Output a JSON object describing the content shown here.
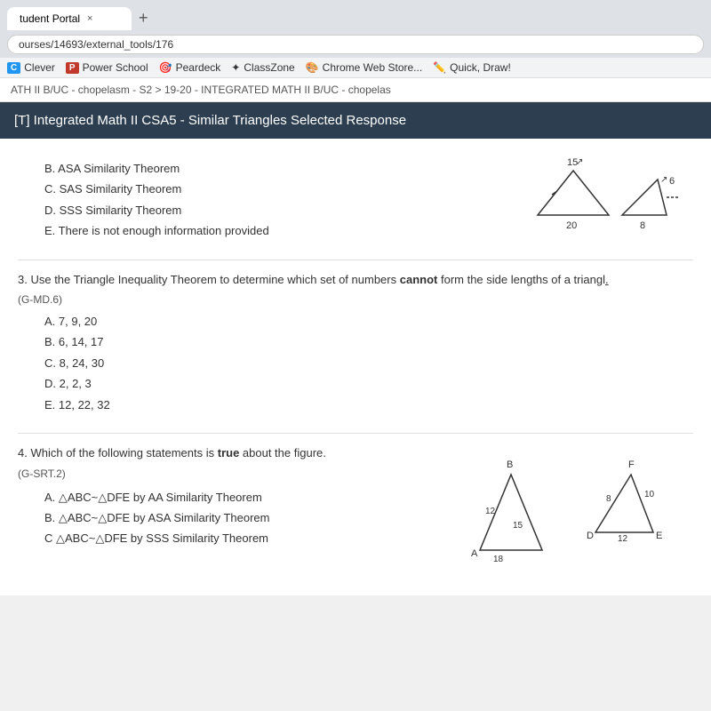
{
  "browser": {
    "tab_label": "tudent Portal",
    "tab_close": "×",
    "tab_new": "+",
    "address": "ourses/14693/external_tools/176"
  },
  "bookmarks": [
    {
      "id": "clever",
      "label": "Clever",
      "badge": "C",
      "color": "#2196F3"
    },
    {
      "id": "powerschool",
      "label": "Power School",
      "badge": "P",
      "color": "#c0392b"
    },
    {
      "id": "peardeck",
      "label": "Peardeck",
      "badge": "🎯"
    },
    {
      "id": "classzone",
      "label": "ClassZone",
      "badge": "✦"
    },
    {
      "id": "chrome-web",
      "label": "Chrome Web Store...",
      "badge": "🎨"
    },
    {
      "id": "quick-draw",
      "label": "Quick, Draw!",
      "badge": "✏️"
    }
  ],
  "breadcrumb": "ATH II B/UC - chopelasm - S2  >  19-20 - INTEGRATED MATH II B/UC - chopelas",
  "page_header": "[T] Integrated Math II CSA5 - Similar Triangles Selected Response",
  "questions": {
    "q2_choices": [
      "B. ASA Similarity Theorem",
      "C. SAS Similarity Theorem",
      "D. SSS Similarity Theorem",
      "E. There is not enough information provided"
    ],
    "q2_diagram": {
      "label1": "15",
      "label2": "6",
      "label3": "20",
      "label4": "8"
    },
    "q3_number": "3.",
    "q3_text": "Use the Triangle Inequality Theorem to determine which set of numbers",
    "q3_bold": "cannot",
    "q3_text2": "form the side lengths of a triangl",
    "q3_tag": "(G-MD.6)",
    "q3_choices": [
      "A. 7, 9, 20",
      "B. 6, 14, 17",
      "C. 8, 24, 30",
      "D. 2, 2, 3",
      "E. 12, 22, 32"
    ],
    "q4_number": "4.",
    "q4_text": "Which of the following statements is",
    "q4_bold": "true",
    "q4_text2": "about the figure.",
    "q4_tag": "(G-SRT.2)",
    "q4_choices": [
      "A. △ABC~△DFE by AA Similarity Theorem",
      "B. △ABC~△DFE by ASA Similarity Theorem",
      "C △ABC~△DFE by SSS Similarity Theorem"
    ],
    "q4_diagram": {
      "b_label": "B",
      "f_label": "F",
      "a_label": "A",
      "d_label": "D",
      "e_label": "E",
      "label12": "12",
      "label15": "15",
      "label18": "18",
      "label8": "8",
      "label10": "10",
      "label12b": "12"
    }
  }
}
